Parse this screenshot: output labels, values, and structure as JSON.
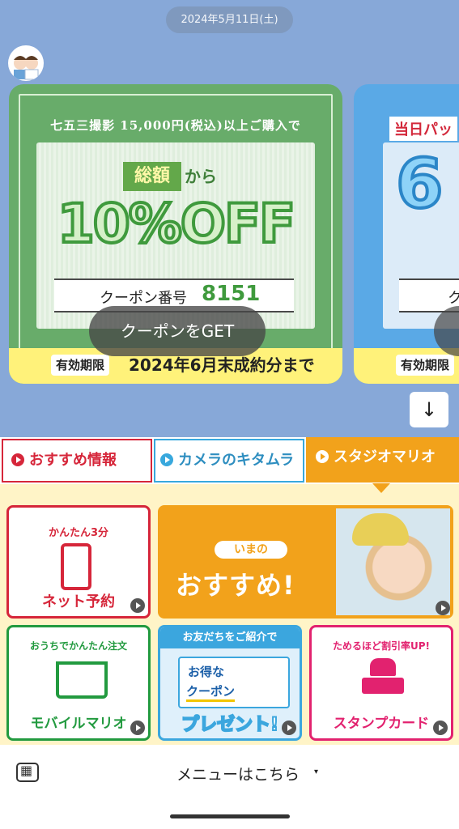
{
  "chat": {
    "date": "2024年5月11日(土)",
    "coupon1": {
      "headline": "七五三撮影 15,000円(税込)以上ご購入で",
      "total_strong": "総額",
      "total_from": "から",
      "discount": "10%OFF",
      "coupon_label": "クーポン番号",
      "coupon_code": "8151",
      "expiry_tag": "有効期限",
      "expiry_text": "2024年6月末成約分まで",
      "get_button": "クーポンをGET"
    },
    "coupon2": {
      "headline": "当日パッ",
      "big_number": "6",
      "coupon_label": "ク",
      "expiry_tag": "有効期限"
    },
    "scroll_down_icon": "↓"
  },
  "menu": {
    "tabs": [
      {
        "label": "おすすめ情報",
        "active": false
      },
      {
        "label": "カメラのキタムラ",
        "active": false
      },
      {
        "label": "スタジオマリオ",
        "active": true
      }
    ],
    "tiles": {
      "reserve": {
        "small": "かんたん3分",
        "big": "ネット予約"
      },
      "recommend": {
        "small": "いまの",
        "big": "おすすめ!"
      },
      "mobile": {
        "small": "おうちでかんたん注文",
        "big": "モバイルマリオ"
      },
      "friend": {
        "head": "お友だちをご紹介で",
        "line1": "お得な",
        "line2": "クーポン",
        "big": "プレゼント!"
      },
      "stamp": {
        "small": "ためるほど割引率UP!",
        "big": "スタンプカード"
      }
    }
  },
  "footer": {
    "menu_label": "メニューはこちら",
    "caret": "▾"
  },
  "colors": {
    "chat_bg": "#87a8d8",
    "coupon_green": "#68ac6a",
    "coupon_blue": "#5aa9e6",
    "brand_red": "#d6263a",
    "brand_orange": "#f2a21b",
    "brand_green": "#229a3f",
    "brand_pink": "#e2226f",
    "brand_blue": "#3ba6de"
  }
}
